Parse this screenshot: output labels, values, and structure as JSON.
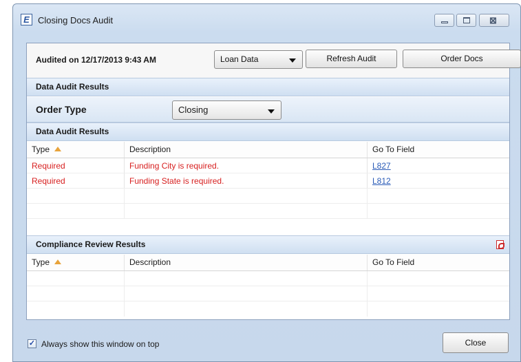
{
  "window": {
    "app_icon_letter": "E",
    "title": "Closing Docs Audit",
    "controls": {
      "minimize": "minimize",
      "maximize": "maximize",
      "close": "close"
    }
  },
  "toolbar": {
    "audited_text": "Audited on 12/17/2013 9:43 AM",
    "data_source_selected": "Loan Data",
    "refresh_label": "Refresh Audit",
    "order_docs_label": "Order Docs"
  },
  "sections": {
    "data_audit_header_1": "Data Audit Results",
    "order_type_label": "Order Type",
    "order_type_selected": "Closing",
    "data_audit_header_2": "Data Audit Results",
    "compliance_header": "Compliance Review Results"
  },
  "audit_table": {
    "columns": [
      "Type",
      "Description",
      "Go To Field"
    ],
    "rows": [
      {
        "type": "Required",
        "description": "Funding City is required.",
        "field": "L827"
      },
      {
        "type": "Required",
        "description": "Funding State is required.",
        "field": "L812"
      }
    ]
  },
  "compliance_table": {
    "columns": [
      "Type",
      "Description",
      "Go To Field"
    ],
    "rows": []
  },
  "footer": {
    "always_on_top_label": "Always show this window on top",
    "always_on_top_checked": true,
    "close_label": "Close"
  },
  "colors": {
    "required_text": "#d72020",
    "link": "#2a5bb7",
    "sort_indicator": "#e8a33b",
    "header_gradient": "#cfdff1"
  },
  "icons": {
    "sort": "sort-ascending-icon",
    "pdf": "pdf-icon",
    "check": "checkmark-icon"
  }
}
